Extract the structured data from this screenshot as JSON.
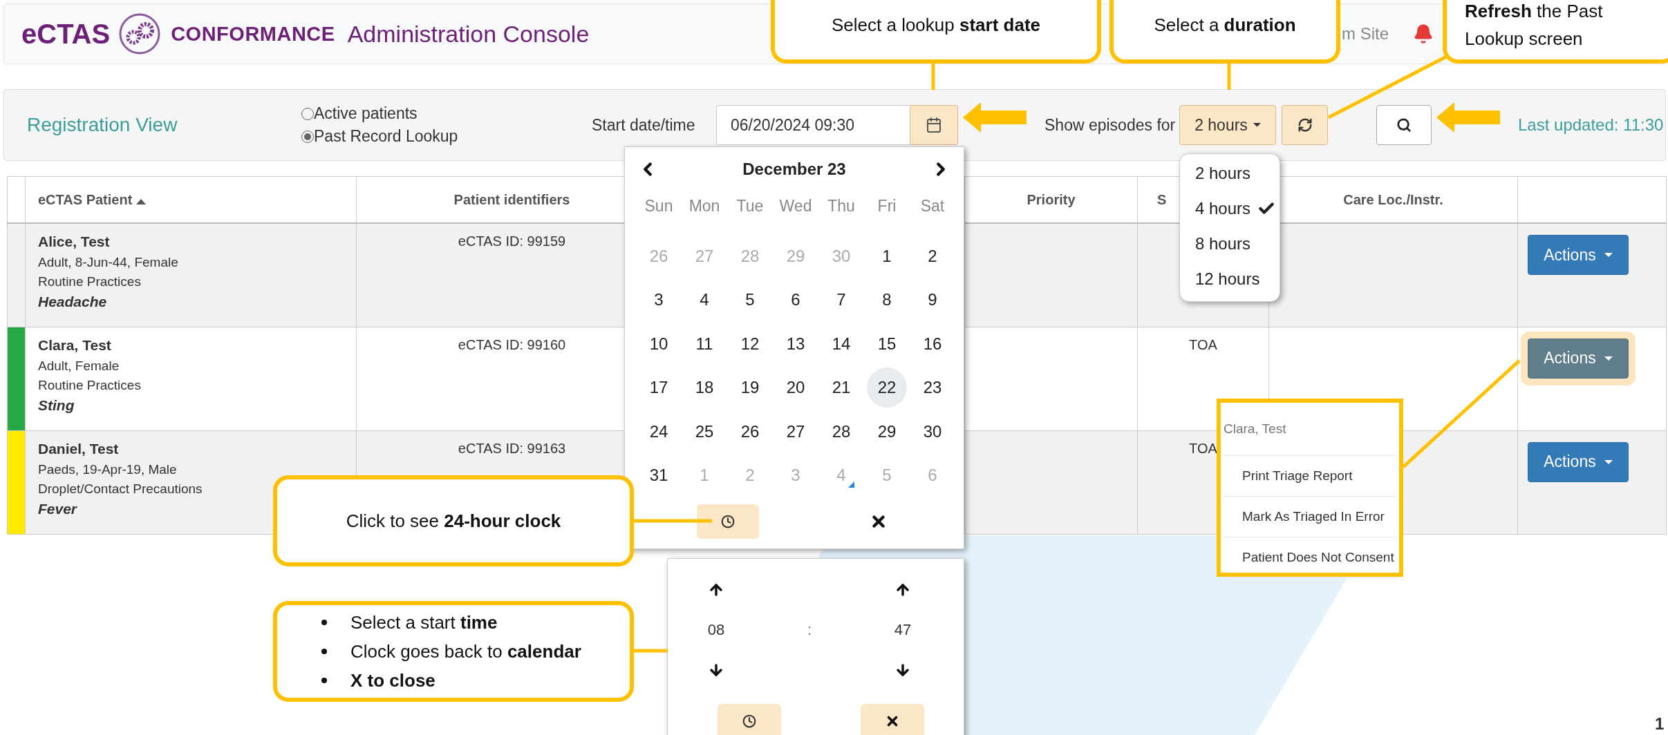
{
  "header": {
    "brand": "eCTAS",
    "brand_sub": "CONFORMANCE",
    "title": "Administration Console",
    "site": "m Site"
  },
  "toolbar": {
    "view_title": "Registration View",
    "modes": [
      {
        "label": "Active patients",
        "selected": false
      },
      {
        "label": "Past Record Lookup",
        "selected": true
      }
    ],
    "start_label": "Start date/time",
    "start_value": "06/20/2024 09:30",
    "episodes_label": "Show episodes for",
    "duration": "2 hours",
    "last_updated": "Last updated: 11:30"
  },
  "duration_menu": [
    {
      "label": "2 hours",
      "selected": false
    },
    {
      "label": "4 hours",
      "selected": true
    },
    {
      "label": "8 hours",
      "selected": false
    },
    {
      "label": "12 hours",
      "selected": false
    }
  ],
  "table": {
    "columns": [
      {
        "label": "eCTAS Patient",
        "sorted": true
      },
      {
        "label": "Patient identifiers",
        "sorted": false
      },
      {
        "label": "Priority",
        "sorted": false
      },
      {
        "label": "S",
        "sorted": false
      },
      {
        "label": "Care Loc./Instr.",
        "sorted": false
      }
    ],
    "rows": [
      {
        "name": "Alice, Test",
        "details": [
          "Adult, 8-Jun-44, Female",
          "Routine Practices"
        ],
        "complaint": "Headache",
        "identifier": "eCTAS ID: 99159",
        "actions": "Actions",
        "highlighted": false
      },
      {
        "color": "#28a745",
        "name": "Clara, Test",
        "details": [
          "Adult, Female",
          "Routine Practices"
        ],
        "complaint": "Sting",
        "identifier": "eCTAS ID: 99160",
        "status": "TOA",
        "actions": "Actions",
        "highlighted": true
      },
      {
        "color": "#ffeb00",
        "name": "Daniel, Test",
        "details": [
          "Paeds, 19-Apr-19, Male",
          "Droplet/Contact Precautions"
        ],
        "complaint": "Fever",
        "identifier": "eCTAS ID: 99163",
        "status": "TOA",
        "actions": "Actions",
        "highlighted": false
      }
    ]
  },
  "calendar": {
    "month": "December 23",
    "weekdays": [
      "Sun",
      "Mon",
      "Tue",
      "Wed",
      "Thu",
      "Fri",
      "Sat"
    ],
    "weeks": [
      [
        {
          "label": "26",
          "muted": true,
          "selected": false,
          "marked": false
        },
        {
          "label": "27",
          "muted": true,
          "selected": false,
          "marked": false
        },
        {
          "label": "28",
          "muted": true,
          "selected": false,
          "marked": false
        },
        {
          "label": "29",
          "muted": true,
          "selected": false,
          "marked": false
        },
        {
          "label": "30",
          "muted": true,
          "selected": false,
          "marked": false
        },
        {
          "label": "1",
          "muted": false,
          "selected": false,
          "marked": false
        },
        {
          "label": "2",
          "muted": false,
          "selected": false,
          "marked": false
        }
      ],
      [
        {
          "label": "3",
          "muted": false,
          "selected": false,
          "marked": false
        },
        {
          "label": "4",
          "muted": false,
          "selected": false,
          "marked": false
        },
        {
          "label": "5",
          "muted": false,
          "selected": false,
          "marked": false
        },
        {
          "label": "6",
          "muted": false,
          "selected": false,
          "marked": false
        },
        {
          "label": "7",
          "muted": false,
          "selected": false,
          "marked": false
        },
        {
          "label": "8",
          "muted": false,
          "selected": false,
          "marked": false
        },
        {
          "label": "9",
          "muted": false,
          "selected": false,
          "marked": false
        }
      ],
      [
        {
          "label": "10",
          "muted": false,
          "selected": false,
          "marked": false
        },
        {
          "label": "11",
          "muted": false,
          "selected": false,
          "marked": false
        },
        {
          "label": "12",
          "muted": false,
          "selected": false,
          "marked": false
        },
        {
          "label": "13",
          "muted": false,
          "selected": false,
          "marked": false
        },
        {
          "label": "14",
          "muted": false,
          "selected": false,
          "marked": false
        },
        {
          "label": "15",
          "muted": false,
          "selected": false,
          "marked": false
        },
        {
          "label": "16",
          "muted": false,
          "selected": false,
          "marked": false
        }
      ],
      [
        {
          "label": "17",
          "muted": false,
          "selected": false,
          "marked": false
        },
        {
          "label": "18",
          "muted": false,
          "selected": false,
          "marked": false
        },
        {
          "label": "19",
          "muted": false,
          "selected": false,
          "marked": false
        },
        {
          "label": "20",
          "muted": false,
          "selected": false,
          "marked": false
        },
        {
          "label": "21",
          "muted": false,
          "selected": false,
          "marked": false
        },
        {
          "label": "22",
          "muted": false,
          "selected": true,
          "marked": false
        },
        {
          "label": "23",
          "muted": false,
          "selected": false,
          "marked": false
        }
      ],
      [
        {
          "label": "24",
          "muted": false,
          "selected": false,
          "marked": false
        },
        {
          "label": "25",
          "muted": false,
          "selected": false,
          "marked": false
        },
        {
          "label": "26",
          "muted": false,
          "selected": false,
          "marked": false
        },
        {
          "label": "27",
          "muted": false,
          "selected": false,
          "marked": false
        },
        {
          "label": "28",
          "muted": false,
          "selected": false,
          "marked": false
        },
        {
          "label": "29",
          "muted": false,
          "selected": false,
          "marked": false
        },
        {
          "label": "30",
          "muted": false,
          "selected": false,
          "marked": false
        }
      ],
      [
        {
          "label": "31",
          "muted": false,
          "selected": false,
          "marked": false
        },
        {
          "label": "1",
          "muted": true,
          "selected": false,
          "marked": false
        },
        {
          "label": "2",
          "muted": true,
          "selected": false,
          "marked": false
        },
        {
          "label": "3",
          "muted": true,
          "selected": false,
          "marked": false
        },
        {
          "label": "4",
          "muted": true,
          "selected": false,
          "marked": true
        },
        {
          "label": "5",
          "muted": true,
          "selected": false,
          "marked": false
        },
        {
          "label": "6",
          "muted": true,
          "selected": false,
          "marked": false
        }
      ]
    ]
  },
  "time_picker": {
    "hours": "08",
    "separator": ":",
    "minutes": "47"
  },
  "actions_menu": {
    "header": "Clara, Test",
    "items": [
      "Print Triage Report",
      "Mark As Triaged In Error",
      "Patient Does Not Consent"
    ]
  },
  "callouts": [
    {
      "kind": "note",
      "text": "Select a lookup **start date**"
    },
    {
      "kind": "note",
      "text": "Select a **duration**"
    },
    {
      "kind": "note",
      "text": "**Refresh** the Past Lookup screen"
    },
    {
      "kind": "note",
      "text": "Click to see **24-hour clock**"
    },
    {
      "kind": "list",
      "items": [
        "Select a start **time**",
        "Clock goes back to **calendar**",
        "**X to close**"
      ]
    }
  ],
  "page_number": "1"
}
